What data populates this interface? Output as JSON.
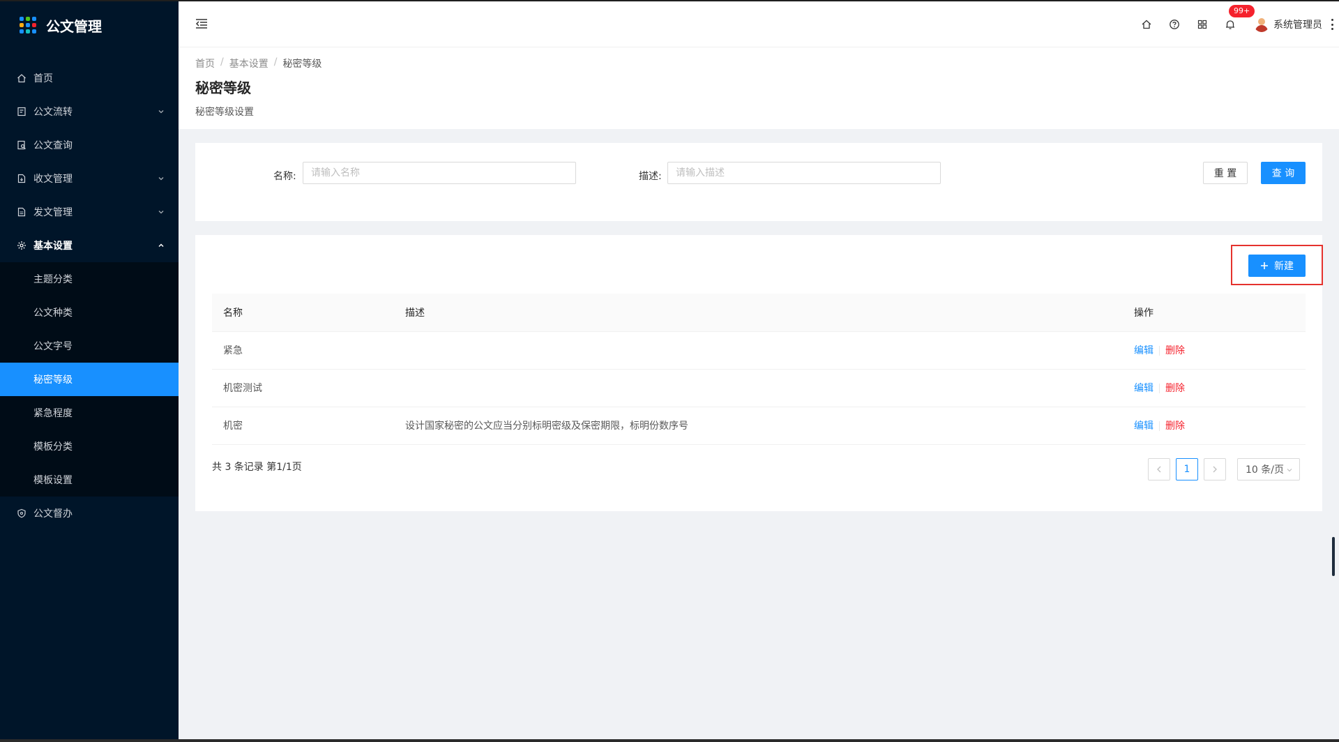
{
  "app": {
    "title": "公文管理"
  },
  "logo_colors": [
    "#1890ff",
    "#52c41a",
    "#1890ff",
    "#faad14",
    "#1890ff",
    "#f5222d",
    "#1890ff",
    "#13c2c2",
    "#1890ff"
  ],
  "sidebar": {
    "items": [
      {
        "label": "首页",
        "icon": "home-icon"
      },
      {
        "label": "公文流转",
        "icon": "document-icon"
      },
      {
        "label": "公文查询",
        "icon": "document-search-icon"
      },
      {
        "label": "收文管理",
        "icon": "file-in-icon"
      },
      {
        "label": "发文管理",
        "icon": "file-out-icon"
      },
      {
        "label": "基本设置",
        "icon": "gear-icon"
      }
    ],
    "submenu": [
      {
        "label": "主题分类"
      },
      {
        "label": "公文种类"
      },
      {
        "label": "公文字号"
      },
      {
        "label": "秘密等级"
      },
      {
        "label": "紧急程度"
      },
      {
        "label": "模板分类"
      },
      {
        "label": "模板设置"
      }
    ],
    "last_item": {
      "label": "公文督办",
      "icon": "shield-icon"
    }
  },
  "header": {
    "notification_badge": "99+",
    "user_name": "系统管理员"
  },
  "breadcrumb": [
    "首页",
    "基本设置",
    "秘密等级"
  ],
  "page": {
    "title": "秘密等级",
    "description": "秘密等级设置"
  },
  "search": {
    "name_label": "名称:",
    "name_placeholder": "请输入名称",
    "desc_label": "描述:",
    "desc_placeholder": "请输入描述",
    "reset_label": "重 置",
    "query_label": "查 询"
  },
  "toolbar": {
    "new_label": "新建"
  },
  "table": {
    "columns": [
      "名称",
      "描述",
      "操作"
    ],
    "rows": [
      {
        "name": "紧急",
        "desc": ""
      },
      {
        "name": "机密测试",
        "desc": ""
      },
      {
        "name": "机密",
        "desc": "设计国家秘密的公文应当分别标明密级及保密期限，标明份数序号"
      }
    ],
    "edit_label": "编辑",
    "delete_label": "删除"
  },
  "pagination": {
    "summary": "共 3 条记录 第1/1页",
    "current_page": "1",
    "page_size": "10 条/页"
  },
  "colors": {
    "sidebar_bg": "#001529",
    "primary": "#1890ff",
    "danger": "#f5222d"
  }
}
